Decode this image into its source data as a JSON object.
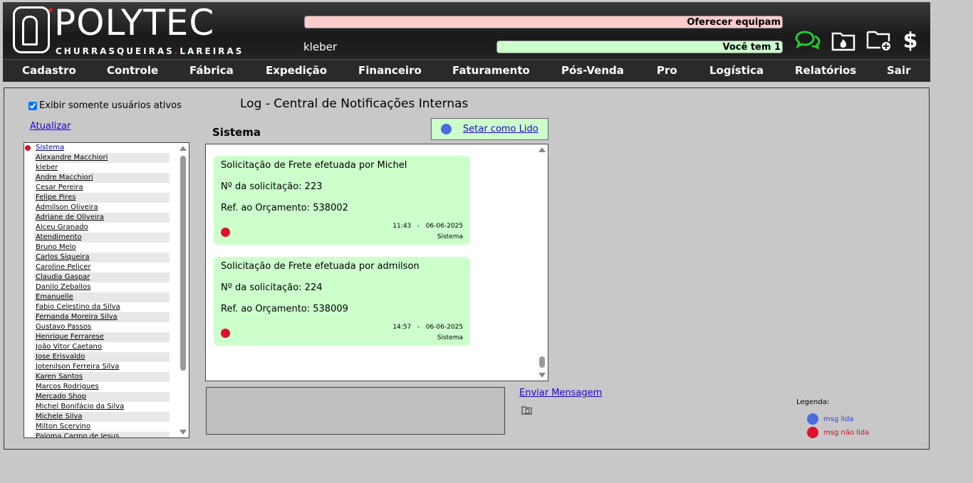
{
  "header": {
    "brand": "POLYTEC",
    "brand_sub_left": "CHURRASQUEIRAS",
    "brand_sub_right": "LAREIRAS",
    "alert_red": "Oferecer equipam",
    "alert_green": "Você tem 1",
    "username": "kleber",
    "icons": [
      "chat-icon",
      "fire-folder-icon",
      "folder-add-icon",
      "dollar-icon"
    ],
    "dollar_symbol": "$"
  },
  "menu": [
    "Cadastro",
    "Controle",
    "Fábrica",
    "Expedição",
    "Financeiro",
    "Faturamento",
    "Pós-Venda",
    "Pro",
    "Logística",
    "Relatórios",
    "Sair"
  ],
  "filters": {
    "only_active_label": "Exibir somente usuários ativos",
    "only_active_checked": true,
    "refresh_label": "Atualizar"
  },
  "page_title": "Log - Central de Notificações Internas",
  "section_title": "Sistema",
  "mark_read_label": "Setar como Lido",
  "users": [
    "Sistema",
    "Alexandre Macchiori",
    "kleber",
    "Andre Macchiori",
    "Cesar Pereira",
    "Felipe Pires",
    "Admilson Oliveira",
    "Adriane de Oliveira",
    "Alceu Granado",
    "Atendimento",
    "Bruno Melo",
    "Carlos Siqueira",
    "Caroline Pelicer",
    "Claudia Gaspar",
    "Danilo Zeballos",
    "Emanuelle",
    "Fabio Celestino da Silva",
    "Fernanda Moreira Silva",
    "Gustavo Passos",
    "Henrique Ferrarese",
    "João Vitor Caetano",
    "Jose Erisvaldo",
    "Jotenilson Ferreira Silva",
    "Karen Santos",
    "Marcos Rodrigues",
    "Mercado Shop",
    "Michel Bonifácio da Silva",
    "Michele Silva",
    "Milton Scervino",
    "Paloma Carmo de Jesus"
  ],
  "messages": [
    {
      "line1": "Solicitação de Frete efetuada por Michel",
      "line2": "Nº da solicitação: 223",
      "line3": "Ref. ao Orçamento: 538002",
      "time": "11:43",
      "date": "06-06-2025",
      "sender": "Sistema"
    },
    {
      "line1": "Solicitação de Frete efetuada por admilson",
      "line2": "Nº da solicitação: 224",
      "line3": "Ref. ao Orçamento: 538009",
      "time": "14:57",
      "date": "06-06-2025",
      "sender": "Sistema"
    }
  ],
  "send_label": "Enviar Mensagem",
  "legend": {
    "title": "Legenda:",
    "read": {
      "label": "msg lida",
      "color": "#4a6ee0"
    },
    "unread": {
      "label": "msg não lida",
      "color": "#e0102a"
    }
  }
}
